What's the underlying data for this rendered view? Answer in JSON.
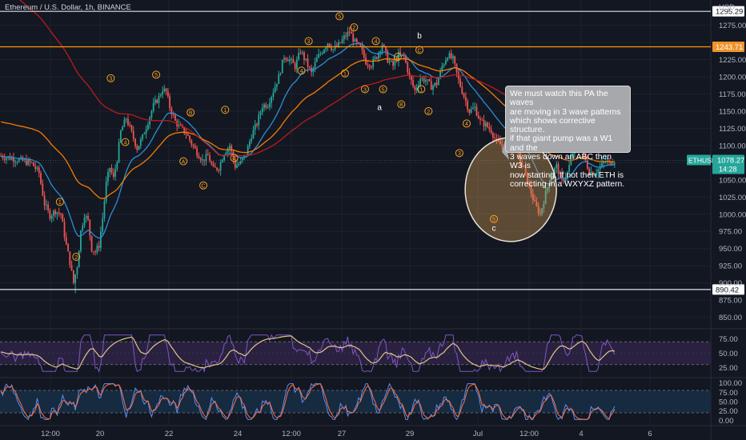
{
  "header": {
    "symbol_line": "Ethereum / U.S. Dollar, 1h, BINANCE"
  },
  "currency": "USD",
  "colors": {
    "bg": "#131722",
    "grid": "#1e222d",
    "up": "#26a69a",
    "down": "#ef5350",
    "ema_fast": "#2b8fd6",
    "ema_slow": "#f57c00",
    "ema_long": "#b71c1c",
    "hline_white": "#e0e3eb",
    "hline_orange": "#ff9800",
    "price_tag": "#26a69a",
    "rsi_fill": "#2a2140",
    "stoch_fill": "#162a40",
    "rsi_line": "#7e57c2",
    "rsi_ma": "#e0c48e",
    "stoch_k": "#5b8def",
    "stoch_d": "#ff7043",
    "wave_label": "#f7a21b"
  },
  "callout_text": "We must watch this PA the waves\nare moving in 3 wave patterns\nwhich shows corrective structure.\nif that giant pump was a W1 and the\n3 waves down an ABC then W3 is\nnow starting. If not then ETH is\ncorrecting in a WXYXZ pattern.",
  "chart_data": {
    "type": "candlestick",
    "price_axis": {
      "ticks": [
        850,
        875,
        900,
        925,
        950,
        975,
        1000,
        1025,
        1050,
        1075,
        1100,
        1125,
        1150,
        1175,
        1200,
        1225,
        1250,
        1275
      ],
      "tick_labels": [
        "850.00",
        "875.00",
        "900.00",
        "925.00",
        "950.00",
        "975.00",
        "1000.00",
        "1025.00",
        "1050.00",
        "",
        "1100.00",
        "1125.00",
        "1150.00",
        "1175.00",
        "1200.00",
        "1225.00",
        "",
        "1275.00"
      ],
      "range": [
        845,
        1310
      ]
    },
    "time_axis": {
      "labels": [
        "12:00",
        "20",
        "22",
        "24",
        "12:00",
        "27",
        "29",
        "Jul",
        "12:00",
        "4",
        "6"
      ],
      "range_hours": [
        0,
        380
      ]
    },
    "horizontal_lines": [
      {
        "price": 1295.29,
        "label": "1295.29",
        "color": "white"
      },
      {
        "price": 1243.71,
        "label": "1243.71",
        "color": "orange"
      },
      {
        "price": 890.42,
        "label": "890.42",
        "color": "white"
      }
    ],
    "current_price": {
      "symbol": "ETHUSD",
      "price": "1078.27",
      "countdown": "14:28"
    },
    "price_path": [
      [
        0,
        1085
      ],
      [
        6,
        1082
      ],
      [
        12,
        1078
      ],
      [
        18,
        1074
      ],
      [
        22,
        1060
      ],
      [
        25,
        1015
      ],
      [
        28,
        998
      ],
      [
        31,
        1005
      ],
      [
        34,
        1000
      ],
      [
        37,
        955
      ],
      [
        39,
        930
      ],
      [
        41,
        900
      ],
      [
        43,
        925
      ],
      [
        45,
        975
      ],
      [
        47,
        1000
      ],
      [
        49,
        990
      ],
      [
        51,
        950
      ],
      [
        53,
        945
      ],
      [
        55,
        955
      ],
      [
        57,
        995
      ],
      [
        59,
        1045
      ],
      [
        61,
        1068
      ],
      [
        63,
        1052
      ],
      [
        65,
        1080
      ],
      [
        67,
        1120
      ],
      [
        70,
        1140
      ],
      [
        73,
        1118
      ],
      [
        76,
        1096
      ],
      [
        79,
        1112
      ],
      [
        82,
        1135
      ],
      [
        85,
        1158
      ],
      [
        88,
        1170
      ],
      [
        90,
        1182
      ],
      [
        92,
        1178
      ],
      [
        94,
        1156
      ],
      [
        97,
        1135
      ],
      [
        100,
        1125
      ],
      [
        103,
        1118
      ],
      [
        106,
        1103
      ],
      [
        109,
        1090
      ],
      [
        112,
        1078
      ],
      [
        115,
        1085
      ],
      [
        118,
        1065
      ],
      [
        121,
        1068
      ],
      [
        124,
        1090
      ],
      [
        127,
        1100
      ],
      [
        130,
        1070
      ],
      [
        133,
        1075
      ],
      [
        136,
        1088
      ],
      [
        139,
        1115
      ],
      [
        142,
        1132
      ],
      [
        145,
        1158
      ],
      [
        148,
        1160
      ],
      [
        151,
        1180
      ],
      [
        154,
        1200
      ],
      [
        157,
        1230
      ],
      [
        160,
        1225
      ],
      [
        163,
        1215
      ],
      [
        166,
        1238
      ],
      [
        169,
        1222
      ],
      [
        172,
        1205
      ],
      [
        175,
        1226
      ],
      [
        178,
        1238
      ],
      [
        181,
        1250
      ],
      [
        184,
        1240
      ],
      [
        187,
        1246
      ],
      [
        190,
        1257
      ],
      [
        193,
        1266
      ],
      [
        196,
        1250
      ],
      [
        199,
        1242
      ],
      [
        202,
        1222
      ],
      [
        205,
        1218
      ],
      [
        208,
        1230
      ],
      [
        211,
        1248
      ],
      [
        214,
        1225
      ],
      [
        217,
        1216
      ],
      [
        220,
        1232
      ],
      [
        223,
        1230
      ],
      [
        226,
        1200
      ],
      [
        229,
        1180
      ],
      [
        232,
        1198
      ],
      [
        235,
        1195
      ],
      [
        238,
        1186
      ],
      [
        241,
        1190
      ],
      [
        244,
        1215
      ],
      [
        247,
        1232
      ],
      [
        250,
        1225
      ],
      [
        253,
        1195
      ],
      [
        256,
        1172
      ],
      [
        259,
        1150
      ],
      [
        262,
        1155
      ],
      [
        265,
        1135
      ],
      [
        268,
        1130
      ],
      [
        271,
        1122
      ],
      [
        274,
        1105
      ],
      [
        277,
        1100
      ],
      [
        280,
        1100
      ],
      [
        283,
        1108
      ],
      [
        286,
        1085
      ],
      [
        289,
        1065
      ],
      [
        292,
        1040
      ],
      [
        295,
        1015
      ],
      [
        298,
        1000
      ],
      [
        301,
        1030
      ],
      [
        304,
        1056
      ],
      [
        307,
        1070
      ],
      [
        310,
        1048
      ],
      [
        313,
        1060
      ],
      [
        316,
        1090
      ],
      [
        319,
        1105
      ],
      [
        322,
        1085
      ],
      [
        325,
        1062
      ],
      [
        328,
        1060
      ],
      [
        331,
        1068
      ],
      [
        334,
        1078
      ],
      [
        336,
        1074
      ],
      [
        338,
        1078
      ]
    ],
    "wave_labels": [
      {
        "t": 33,
        "p": 1018,
        "text": "1",
        "style": "circle"
      },
      {
        "t": 42,
        "p": 938,
        "text": "2",
        "style": "circle"
      },
      {
        "t": 61,
        "p": 1198,
        "text": "3",
        "style": "circle"
      },
      {
        "t": 69,
        "p": 1105,
        "text": "4",
        "style": "circle"
      },
      {
        "t": 86,
        "p": 1203,
        "text": "5",
        "style": "circle"
      },
      {
        "t": 105,
        "p": 1148,
        "text": "B",
        "style": "circle"
      },
      {
        "t": 101,
        "p": 1077,
        "text": "A",
        "style": "circle"
      },
      {
        "t": 112,
        "p": 1042,
        "text": "C",
        "style": "circle"
      },
      {
        "t": 124,
        "p": 1152,
        "text": "1",
        "style": "circle"
      },
      {
        "t": 129,
        "p": 1082,
        "text": "2",
        "style": "circle"
      },
      {
        "t": 170,
        "p": 1252,
        "text": "3",
        "style": "circle"
      },
      {
        "t": 166,
        "p": 1209,
        "text": "4",
        "style": "circle"
      },
      {
        "t": 187,
        "p": 1288,
        "text": "5",
        "style": "circle"
      },
      {
        "t": 190,
        "p": 1205,
        "text": "1",
        "style": "circle"
      },
      {
        "t": 195,
        "p": 1272,
        "text": "2",
        "style": "circle"
      },
      {
        "t": 201,
        "p": 1182,
        "text": "3",
        "style": "circle"
      },
      {
        "t": 207,
        "p": 1252,
        "text": "4",
        "style": "circle"
      },
      {
        "t": 211,
        "p": 1182,
        "text": "5",
        "style": "circle"
      },
      {
        "t": 219,
        "p": 1229,
        "text": "A",
        "style": "circle"
      },
      {
        "t": 221,
        "p": 1160,
        "text": "B",
        "style": "circle"
      },
      {
        "t": 231,
        "p": 1239,
        "text": "C",
        "style": "circle"
      },
      {
        "t": 209,
        "p": 1156,
        "text": "a",
        "style": "plain"
      },
      {
        "t": 231,
        "p": 1260,
        "text": "b",
        "style": "plain"
      },
      {
        "t": 232,
        "p": 1182,
        "text": "1",
        "style": "circle"
      },
      {
        "t": 236,
        "p": 1150,
        "text": "2",
        "style": "circle"
      },
      {
        "t": 253,
        "p": 1089,
        "text": "3",
        "style": "circle"
      },
      {
        "t": 257,
        "p": 1132,
        "text": "4",
        "style": "circle"
      },
      {
        "t": 272,
        "p": 993,
        "text": "5",
        "style": "circle"
      },
      {
        "t": 272,
        "p": 980,
        "text": "c",
        "style": "plain"
      }
    ],
    "annotation_circle": {
      "t": 280,
      "p": 1050,
      "label": ""
    },
    "rsi": {
      "ticks": [
        25,
        50,
        75
      ],
      "tick_labels": [
        "25.00",
        "50.00",
        "75.00"
      ],
      "bands": [
        30,
        70
      ],
      "range": [
        10,
        90
      ]
    },
    "stoch": {
      "ticks": [
        0,
        25,
        50,
        75,
        100
      ],
      "tick_labels": [
        "0.00",
        "25.00",
        "50.00",
        "75.00",
        "100.00"
      ],
      "bands": [
        20,
        80
      ],
      "range": [
        -10,
        110
      ]
    }
  }
}
